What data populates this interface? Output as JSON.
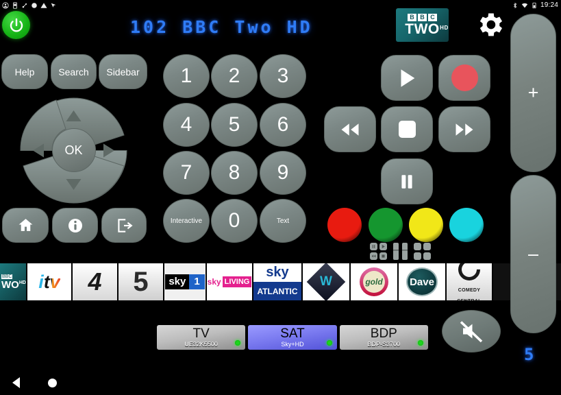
{
  "statusbar": {
    "icons": [
      "account-icon",
      "sim-card-icon",
      "usb-debug-icon",
      "record-icon",
      "warning-icon",
      "location-icon"
    ],
    "right_icons": [
      "bluetooth-icon",
      "wifi-icon",
      "battery-icon"
    ],
    "time": "19:24"
  },
  "header": {
    "power_label": "power-icon",
    "channel_display": "102 BBC Two HD",
    "channel_logo": {
      "brand": "BBC",
      "name": "TWO",
      "quality": "HD"
    },
    "settings_label": "gear-icon"
  },
  "left_cluster": {
    "help_label": "Help",
    "search_label": "Search",
    "sidebar_label": "Sidebar",
    "ok_label": "OK",
    "dpad": {
      "up": "up-arrow",
      "down": "down-arrow",
      "left": "left-arrow",
      "right": "right-arrow"
    },
    "home_label": "home-icon",
    "info_label": "info-icon",
    "exit_label": "exit-icon"
  },
  "keypad": {
    "keys": [
      {
        "label": "1",
        "name": "key-1"
      },
      {
        "label": "2",
        "name": "key-2"
      },
      {
        "label": "3",
        "name": "key-3"
      },
      {
        "label": "4",
        "name": "key-4"
      },
      {
        "label": "5",
        "name": "key-5"
      },
      {
        "label": "6",
        "name": "key-6"
      },
      {
        "label": "7",
        "name": "key-7"
      },
      {
        "label": "8",
        "name": "key-8"
      },
      {
        "label": "9",
        "name": "key-9"
      },
      {
        "label": "Interactive",
        "name": "key-interactive"
      },
      {
        "label": "0",
        "name": "key-0"
      },
      {
        "label": "Text",
        "name": "key-text"
      }
    ]
  },
  "transport": {
    "play": "play-icon",
    "record": "record-icon",
    "rewind": "rewind-icon",
    "stop": "stop-icon",
    "forward": "fast-forward-icon",
    "pause": "pause-icon",
    "record_color": "#e8545c"
  },
  "color_buttons": [
    {
      "name": "red-button",
      "color": "#e81b10"
    },
    {
      "name": "green-button",
      "color": "#15962f"
    },
    {
      "name": "yellow-button",
      "color": "#f1e718"
    },
    {
      "name": "cyan-button",
      "color": "#19d3de"
    }
  ],
  "channel_strip": [
    {
      "name": "bbc-two-hd",
      "text": "BBC TWO HD"
    },
    {
      "name": "itv",
      "text": "itv"
    },
    {
      "name": "channel-4",
      "text": "4"
    },
    {
      "name": "channel-5",
      "text": "5"
    },
    {
      "name": "sky-1",
      "text": "sky 1"
    },
    {
      "name": "sky-living",
      "text": "sky LIVING"
    },
    {
      "name": "sky-atlantic",
      "text": "sky ATLANTIC"
    },
    {
      "name": "w-channel",
      "text": "W"
    },
    {
      "name": "gold",
      "text": "gold"
    },
    {
      "name": "dave",
      "text": "Dave"
    },
    {
      "name": "comedy-central",
      "text": "COMEDY CENTRAL"
    }
  ],
  "devices": [
    {
      "name": "TV",
      "model": "UE32K5500",
      "selected": false
    },
    {
      "name": "SAT",
      "model": "Sky+HD",
      "selected": true
    },
    {
      "name": "BDP",
      "model": "BDP-S3700",
      "selected": false
    }
  ],
  "volume": {
    "up_label": "+",
    "down_label": "–",
    "mute_label": "mute-icon",
    "level_display": "5"
  },
  "navbar": {
    "back": "back-icon",
    "home": "home-circle-icon"
  }
}
